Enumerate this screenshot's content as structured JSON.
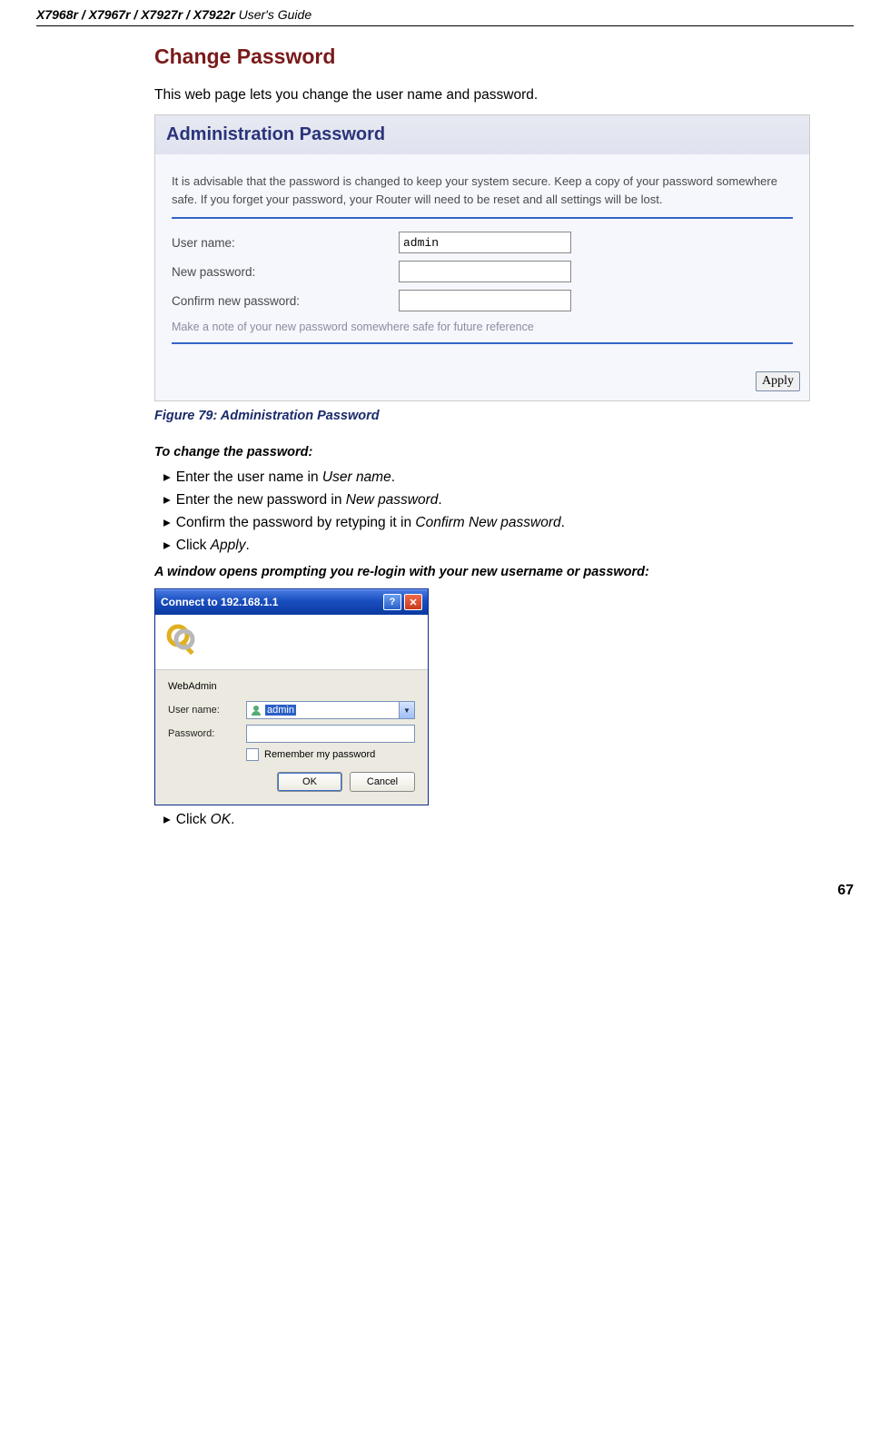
{
  "header": {
    "models": "X7968r / X7967r / X7927r / X7922r",
    "suffix": " User's Guide"
  },
  "section_title": "Change Password",
  "intro": "This web page lets you change the user name and password.",
  "admin": {
    "banner": "Administration Password",
    "advice": "It is advisable that the password is changed to keep your system secure. Keep a copy of your password somewhere safe. If you forget your password, your Router will need to be reset and all settings will be lost.",
    "rows": {
      "user_label": "User name:",
      "user_value": "admin",
      "new_label": "New password:",
      "confirm_label": "Confirm new password:"
    },
    "note": "Make a note of your new password somewhere safe for future reference",
    "apply": "Apply"
  },
  "figure_caption": "Figure 79: Administration Password",
  "subhead1": "To change the password:",
  "steps1": {
    "a_pre": "Enter the user name in ",
    "a_em": "User name",
    "a_post": ".",
    "b_pre": "Enter the new password in ",
    "b_em": "New password",
    "b_post": ".",
    "c_pre": "Confirm the password by retyping it in ",
    "c_em": "Confirm New password",
    "c_post": ".",
    "d_pre": "Click ",
    "d_em": "Apply",
    "d_post": "."
  },
  "subhead2": "A window opens prompting you re-login with your new username or password:",
  "login": {
    "title": "Connect to 192.168.1.1",
    "realm": "WebAdmin",
    "user_label": "User name:",
    "user_value": "admin",
    "pass_label": "Password:",
    "remember": "Remember my password",
    "ok": "OK",
    "cancel": "Cancel"
  },
  "steps2": {
    "a_pre": "Click ",
    "a_em": "OK",
    "a_post": "."
  },
  "page_number": "67",
  "arrow": "▸"
}
